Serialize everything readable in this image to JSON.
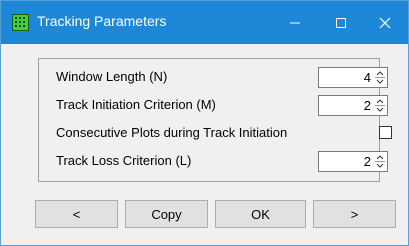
{
  "window": {
    "title": "Tracking Parameters",
    "accent_color": "#1e88d8",
    "icon": "tracking-grid-icon"
  },
  "titlebar_controls": [
    "minimize-icon",
    "maximize-icon",
    "close-icon"
  ],
  "params": {
    "window_length": {
      "label": "Window Length (N)",
      "value": "4"
    },
    "track_initiation": {
      "label": "Track Initiation Criterion (M)",
      "value": "2"
    },
    "consecutive_plots": {
      "label": "Consecutive Plots during Track Initiation",
      "checked": false
    },
    "track_loss": {
      "label": "Track Loss Criterion (L)",
      "value": "2"
    }
  },
  "buttons": {
    "prev": "<",
    "copy": "Copy",
    "ok": "OK",
    "next": ">"
  }
}
